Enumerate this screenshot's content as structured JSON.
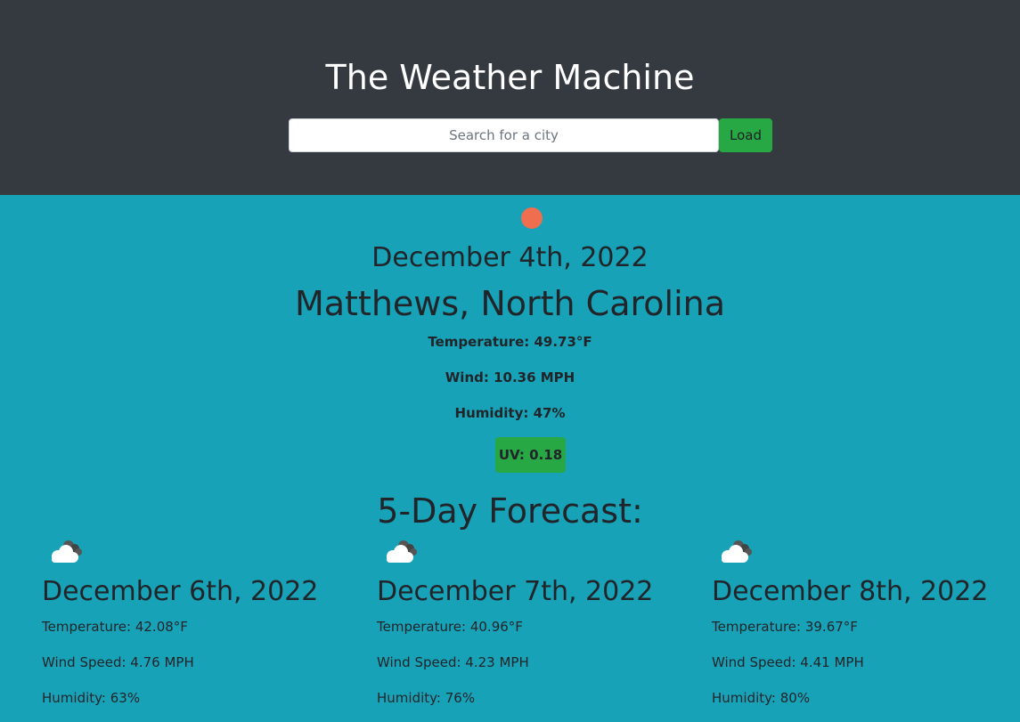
{
  "header": {
    "title": "The Weather Machine",
    "search_placeholder": "Search for a city",
    "search_value": "",
    "load_label": "Load"
  },
  "current": {
    "icon": "sun-icon",
    "date": "December 4th, 2022",
    "city": "Matthews, North Carolina",
    "temperature": "Temperature: 49.73°F",
    "wind": "Wind: 10.36 MPH",
    "humidity": "Humidity: 47%",
    "uv": "UV: 0.18",
    "uv_color": "#28a745",
    "sun_color": "#ee6e4f"
  },
  "forecast": {
    "title": "5-Day Forecast:",
    "days": [
      {
        "icon": "cloudy-icon",
        "date": "December 6th, 2022",
        "temperature": "Temperature: 42.08°F",
        "wind": "Wind Speed: 4.76 MPH",
        "humidity": "Humidity: 63%"
      },
      {
        "icon": "cloudy-icon",
        "date": "December 7th, 2022",
        "temperature": "Temperature: 40.96°F",
        "wind": "Wind Speed: 4.23 MPH",
        "humidity": "Humidity: 76%"
      },
      {
        "icon": "cloudy-icon",
        "date": "December 8th, 2022",
        "temperature": "Temperature: 39.67°F",
        "wind": "Wind Speed: 4.41 MPH",
        "humidity": "Humidity: 80%"
      }
    ]
  },
  "colors": {
    "header_bg": "#343a40",
    "page_bg": "#17a2b8",
    "button_bg": "#28a745"
  }
}
